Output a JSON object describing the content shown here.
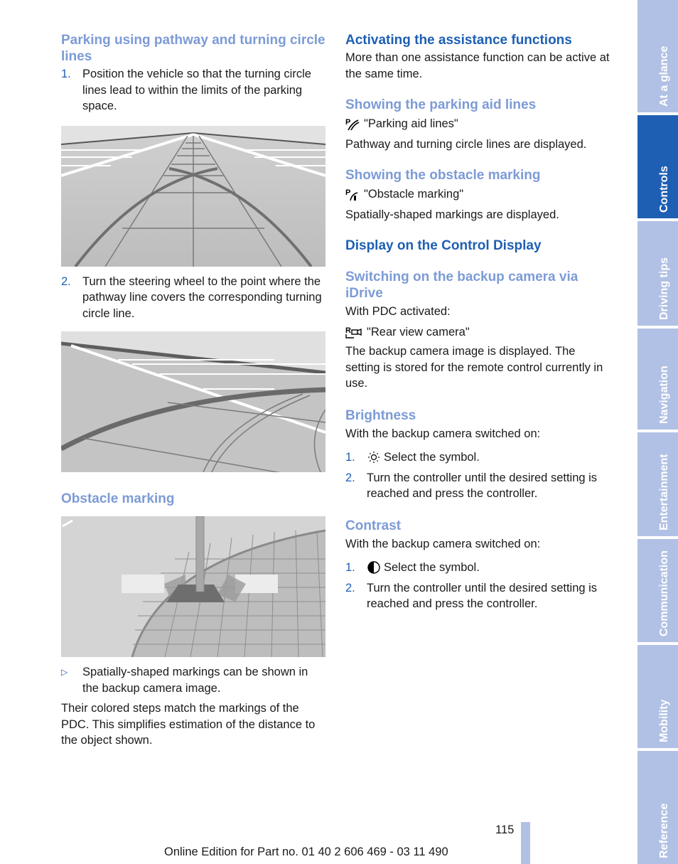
{
  "left": {
    "heading1": "Parking using pathway and turning circle lines",
    "step1_num": "1.",
    "step1_text": "Position the vehicle so that the turning circle lines lead to within the limits of the parking space.",
    "figure1_label": "Rear camera view with pathway and turning circle lines",
    "step2_num": "2.",
    "step2_text": "Turn the steering wheel to the point where the pathway line covers the corresponding turning circle line.",
    "figure2_label": "Rear camera view with pathway line covering turning circle line",
    "heading2": "Obstacle marking",
    "figure3_label": "Rear camera view with obstacle marking",
    "bullet_mark": "▷",
    "bullet_text": "Spatially-shaped markings can be shown in the backup camera image.",
    "para": "Their colored steps match the markings of the PDC. This simplifies estimation of the distance to the object shown."
  },
  "right": {
    "heading_activating": "Activating the assistance functions",
    "para_activating": "More than one assistance function can be active at the same time.",
    "heading_parking_aid": "Showing the parking aid lines",
    "parking_aid_item": "\"Parking aid lines\"",
    "parking_aid_desc": "Pathway and turning circle lines are displayed.",
    "heading_obstacle": "Showing the obstacle marking",
    "obstacle_item": "\"Obstacle marking\"",
    "obstacle_desc": "Spatially-shaped markings are displayed.",
    "heading_display": "Display on the Control Display",
    "heading_switching": "Switching on the backup camera via iDrive",
    "switching_pre": "With PDC activated:",
    "rear_cam_item": "\"Rear view camera\"",
    "switching_desc": "The backup camera image is displayed. The setting is stored for the remote control currently in use.",
    "heading_brightness": "Brightness",
    "brightness_pre": "With the backup camera switched on:",
    "brightness_steps": [
      {
        "num": "1.",
        "text": "Select the symbol."
      },
      {
        "num": "2.",
        "text": "Turn the controller until the desired setting is reached and press the controller."
      }
    ],
    "heading_contrast": "Contrast",
    "contrast_pre": "With the backup camera switched on:",
    "contrast_steps": [
      {
        "num": "1.",
        "text": "Select the symbol."
      },
      {
        "num": "2.",
        "text": "Turn the controller until the desired setting is reached and press the controller."
      }
    ]
  },
  "tabs": [
    {
      "label": "At a glance",
      "active": false
    },
    {
      "label": "Controls",
      "active": true
    },
    {
      "label": "Driving tips",
      "active": false
    },
    {
      "label": "Navigation",
      "active": false
    },
    {
      "label": "Entertainment",
      "active": false
    },
    {
      "label": "Communication",
      "active": false
    },
    {
      "label": "Mobility",
      "active": false
    },
    {
      "label": "Reference",
      "active": false
    }
  ],
  "footer": {
    "page_number": "115",
    "edition": "Online Edition for Part no. 01 40 2 606 469 - 03 11 490"
  },
  "colors": {
    "heading_light": "#7c9bd6",
    "heading_dark": "#1e5fb3",
    "tab_inactive": "#b1c1e5",
    "tab_active": "#1e5fb3"
  }
}
